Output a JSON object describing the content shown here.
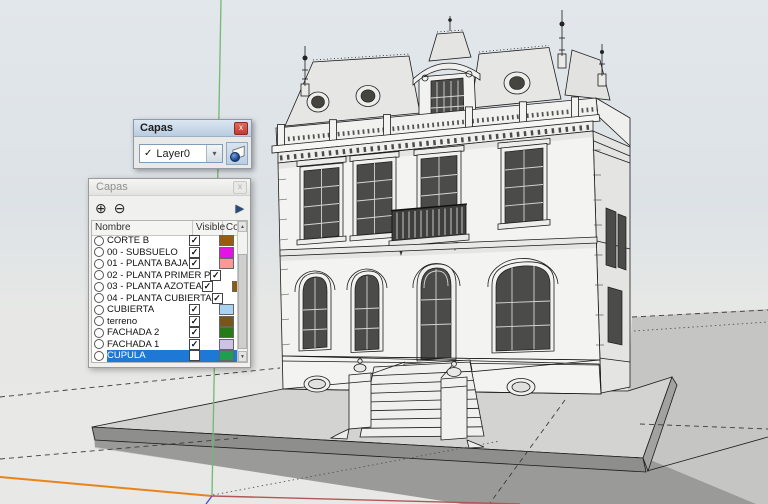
{
  "mini_toolbar": {
    "title": "Capas",
    "close_glyph": "x",
    "combo": {
      "check_glyph": "✓",
      "value": "Layer0",
      "dropdown_glyph": "▾"
    }
  },
  "layers_dialog": {
    "title": "Capas",
    "close_glyph": "x",
    "toolbar": {
      "add_glyph": "⊕",
      "remove_glyph": "⊖",
      "detail_glyph": "▶"
    },
    "columns": {
      "name": "Nombre",
      "visible": "Visible",
      "color": "Co..."
    },
    "scrollbar": {
      "up_glyph": "▲",
      "down_glyph": "▼"
    },
    "check_glyph": "✓",
    "layers": [
      {
        "name": "CORTE B",
        "visible": true,
        "color": "#9A5B10",
        "selected": false
      },
      {
        "name": "00 - SUBSUELO",
        "visible": true,
        "color": "#E512E5",
        "selected": false
      },
      {
        "name": "01 - PLANTA BAJA",
        "visible": true,
        "color": "#FC9898",
        "selected": false
      },
      {
        "name": "02 - PLANTA PRIMER P",
        "visible": true,
        "color": "#C2EFC8",
        "selected": false
      },
      {
        "name": "03 - PLANTA AZOTEA",
        "visible": true,
        "color": "#8F5A10",
        "selected": false
      },
      {
        "name": "04 - PLANTA CUBIERTA",
        "visible": true,
        "color": "#8C8C8C",
        "selected": false
      },
      {
        "name": "CUBIERTA",
        "visible": true,
        "color": "#A8D4F4",
        "selected": false
      },
      {
        "name": "terreno",
        "visible": true,
        "color": "#7A5518",
        "selected": false
      },
      {
        "name": "FACHADA 2",
        "visible": true,
        "color": "#277A18",
        "selected": false
      },
      {
        "name": "FACHADA 1",
        "visible": true,
        "color": "#CFC2EA",
        "selected": false
      },
      {
        "name": "CUPULA",
        "visible": false,
        "color": "#1F9E50",
        "selected": true
      }
    ]
  },
  "colors": {
    "selection_blue": "#1E78D6",
    "axis_green": "#73B873",
    "axis_orange": "#E8831D",
    "axis_red": "#B05858",
    "axis_blue": "#5252CC",
    "terrain_gray": "#C5C5C3",
    "shadow_gray": "#9A9A98"
  }
}
